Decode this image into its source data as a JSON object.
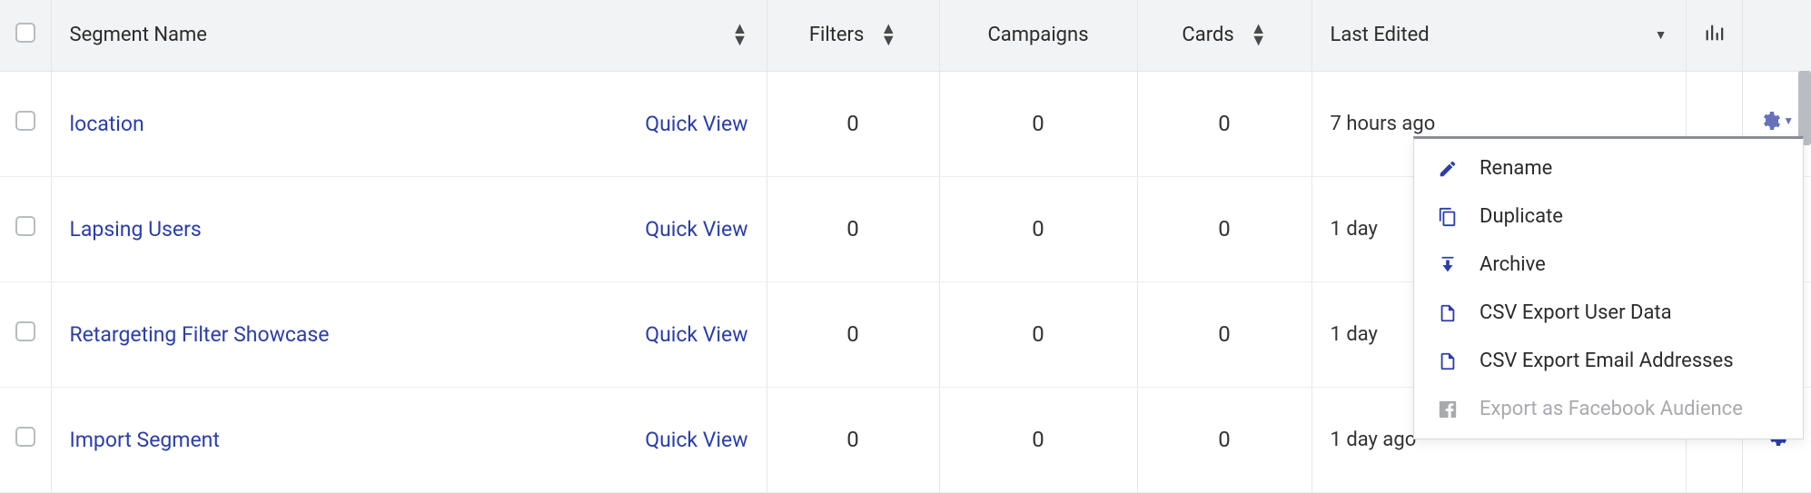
{
  "columns": {
    "segment_name": "Segment Name",
    "filters": "Filters",
    "campaigns": "Campaigns",
    "cards": "Cards",
    "last_edited": "Last Edited"
  },
  "quick_view_label": "Quick View",
  "rows": [
    {
      "name": "location",
      "filters": "0",
      "campaigns": "0",
      "cards": "0",
      "last_edited": "7 hours ago"
    },
    {
      "name": "Lapsing Users",
      "filters": "0",
      "campaigns": "0",
      "cards": "0",
      "last_edited": "1 day"
    },
    {
      "name": "Retargeting Filter Showcase",
      "filters": "0",
      "campaigns": "0",
      "cards": "0",
      "last_edited": "1 day"
    },
    {
      "name": "Import Segment",
      "filters": "0",
      "campaigns": "0",
      "cards": "0",
      "last_edited": "1 day ago"
    }
  ],
  "menu": {
    "rename": "Rename",
    "duplicate": "Duplicate",
    "archive": "Archive",
    "csv_user": "CSV Export User Data",
    "csv_email": "CSV Export Email Addresses",
    "facebook": "Export as Facebook Audience"
  }
}
